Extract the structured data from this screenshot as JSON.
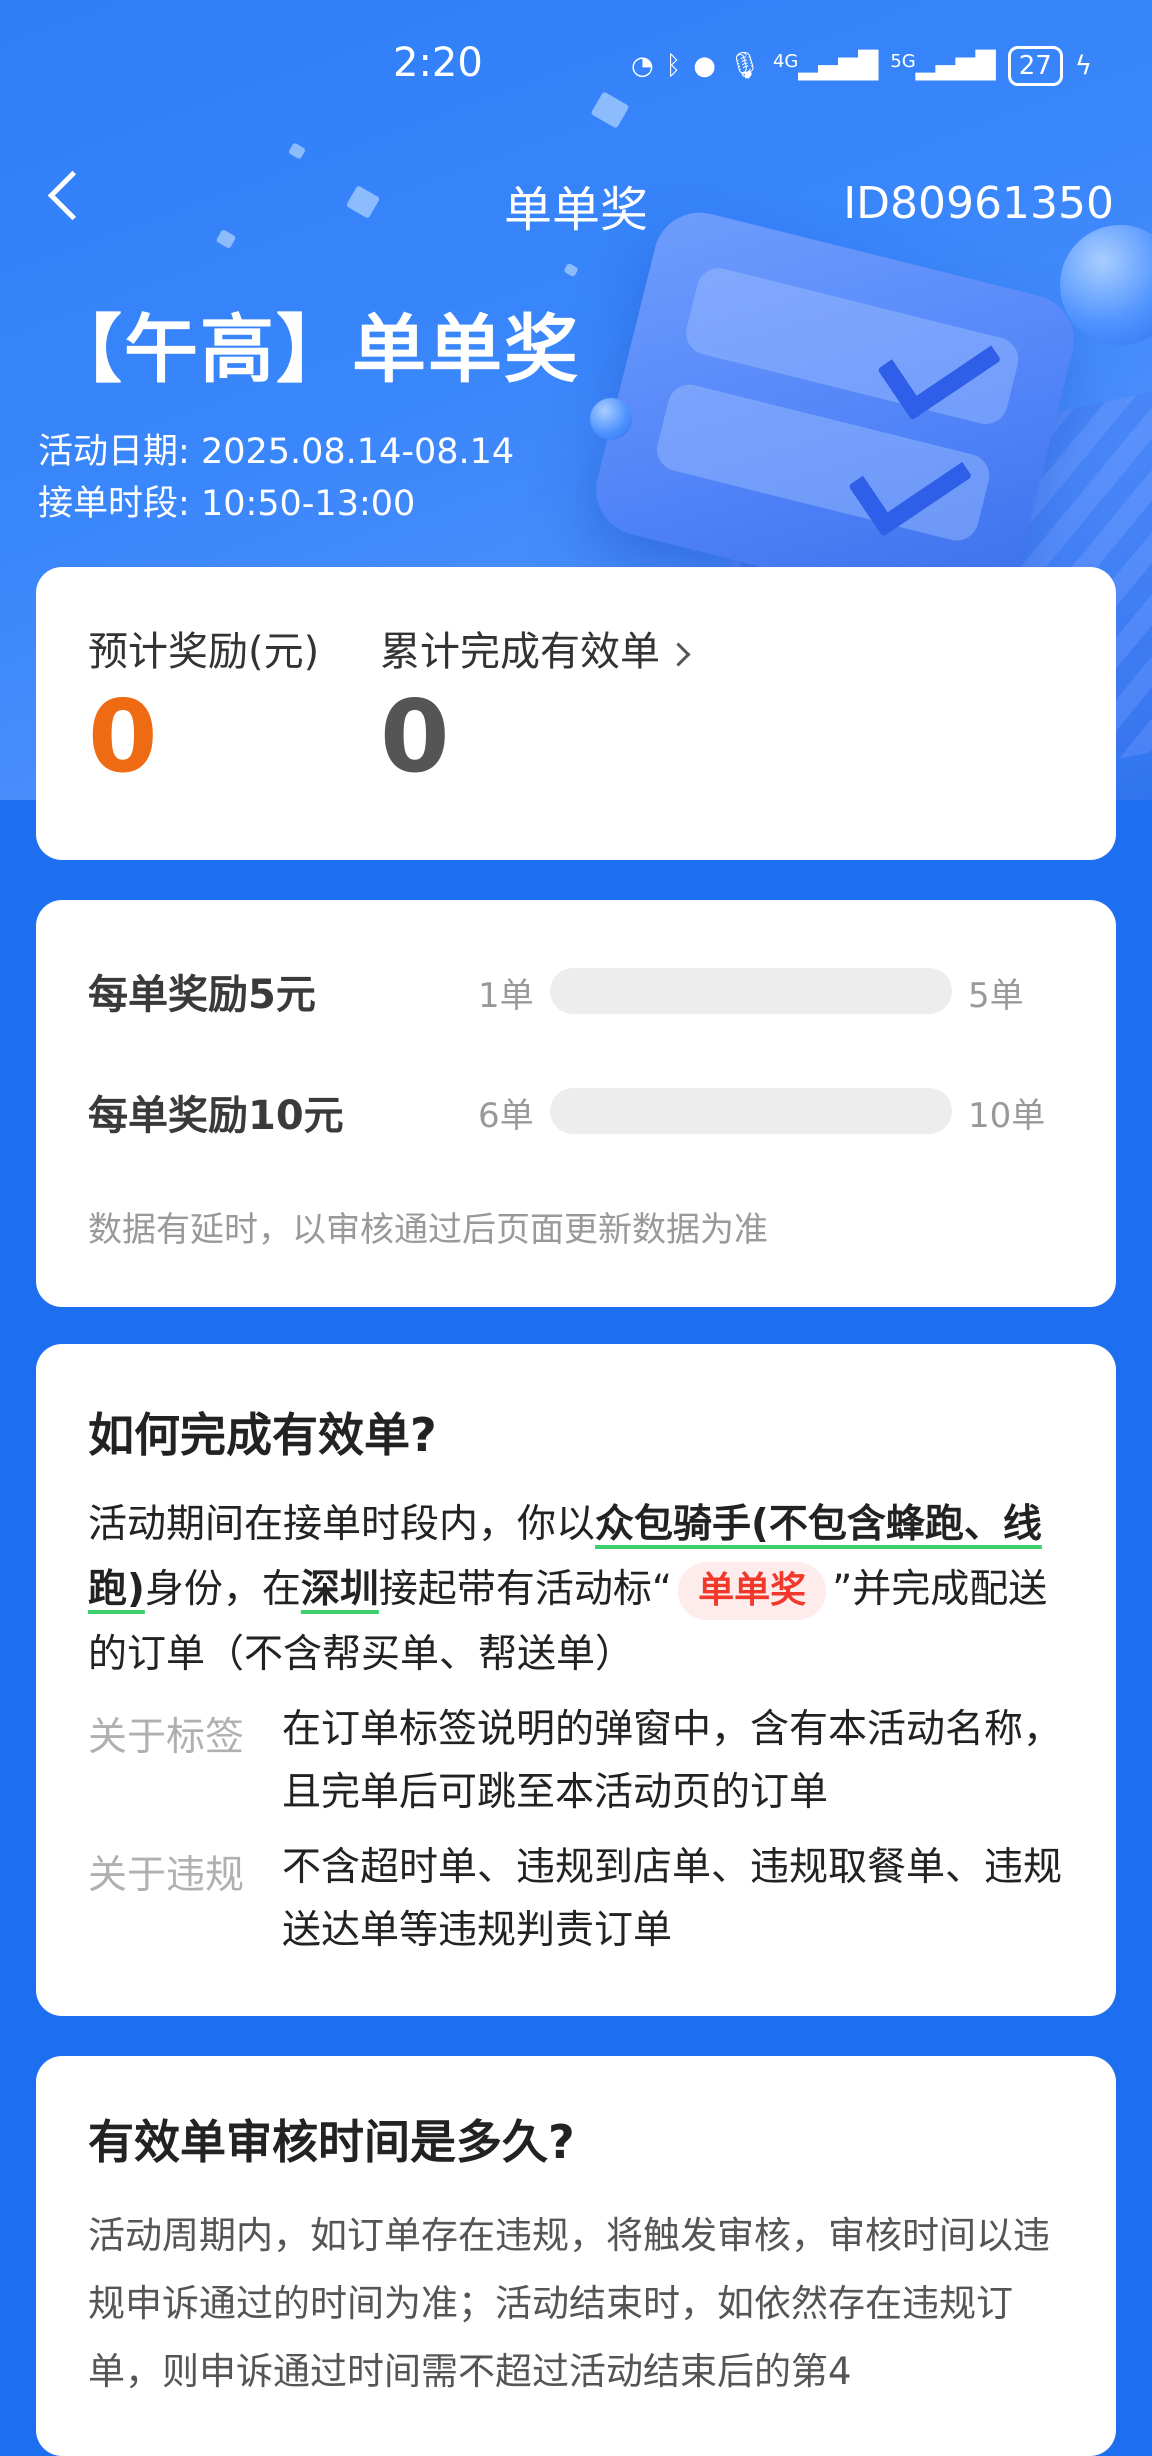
{
  "status_bar": {
    "time": "2:20",
    "battery": "27",
    "network_4g": "4G",
    "network_5g": "5G"
  },
  "nav": {
    "title": "单单奖",
    "id": "ID80961350"
  },
  "hero": {
    "title": "【午高】单单奖",
    "date_label": "活动日期:",
    "date_value": "2025.08.14-08.14",
    "time_label": "接单时段:",
    "time_value": "10:50-13:00"
  },
  "stats": {
    "reward_label": "预计奖励(元)",
    "reward_value": "0",
    "orders_label": "累计完成有效单",
    "orders_value": "0"
  },
  "tiers": {
    "items": [
      {
        "label": "每单奖励5元",
        "min": "1单",
        "max": "5单",
        "progress": 0
      },
      {
        "label": "每单奖励10元",
        "min": "6单",
        "max": "10单",
        "progress": 0
      }
    ],
    "note": "数据有延时，以审核通过后页面更新数据为准"
  },
  "how": {
    "title": "如何完成有效单?",
    "p1": "活动期间在接单时段内，你以",
    "p2": "众包骑手(不包含蜂跑、线跑)",
    "p3": "身份，在",
    "p4": "深圳",
    "p5": "接起带有活动标“",
    "tag": "单单奖",
    "p6": "”并完成配送的订单（不含帮买单、帮送单）",
    "rows": [
      {
        "label": "关于标签",
        "text": "在订单标签说明的弹窗中，含有本活动名称，且完单后可跳至本活动页的订单"
      },
      {
        "label": "关于违规",
        "text": "不含超时单、违规到店单、违规取餐单、违规送达单等违规判责订单"
      }
    ]
  },
  "review": {
    "title": "有效单审核时间是多久?",
    "text": "活动周期内，如订单存在违规，将触发审核，审核时间以违规申诉通过的时间为准；活动结束时，如依然存在违规订单，则申诉通过时间需不超过活动结束后的第4"
  },
  "colors": {
    "accent_orange": "#ee6a13",
    "brand_blue": "#1e6ff0",
    "tag_red": "#f0392b",
    "underline_green": "#3ccf6a"
  }
}
